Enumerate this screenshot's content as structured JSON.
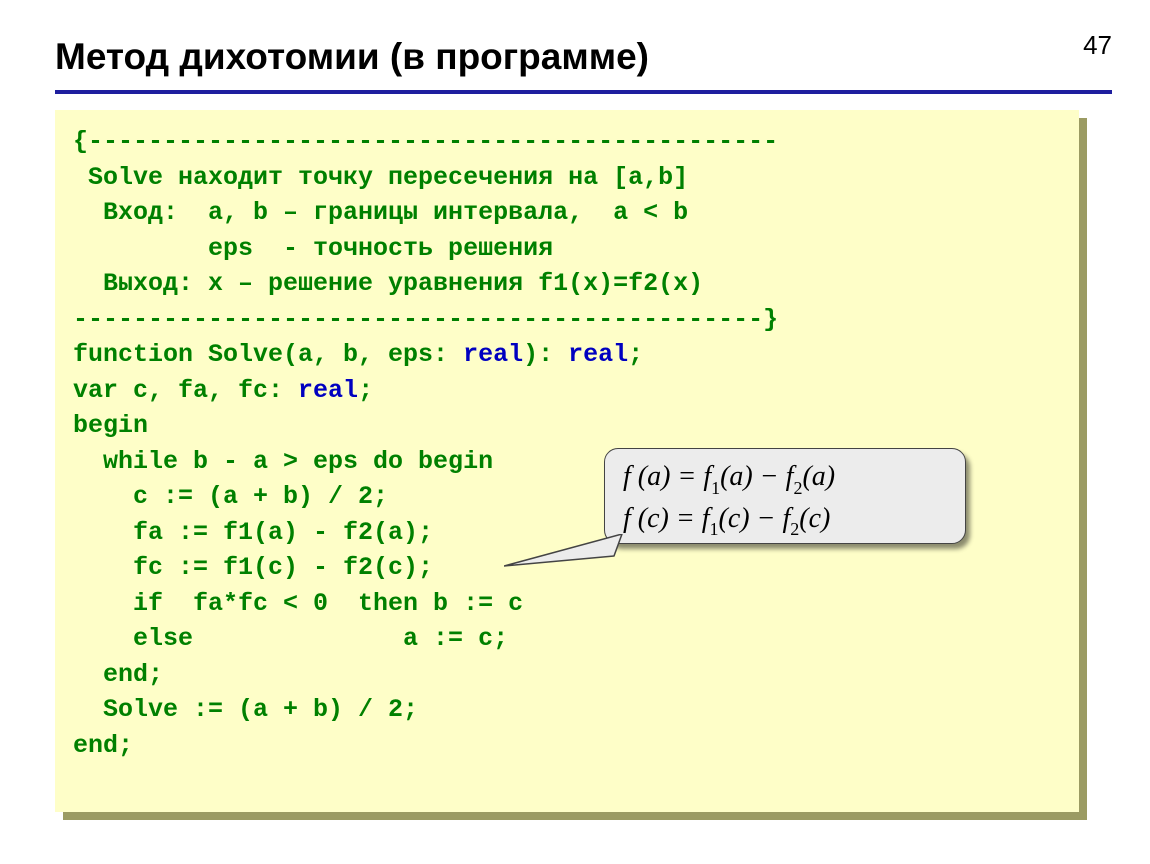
{
  "page_number": "47",
  "title": "Метод дихотомии (в программе)",
  "code": {
    "c01": "{----------------------------------------------",
    "c02": " Solve находит точку пересечения на [a,b]",
    "c03": "  Вход:  a, b – границы интервала,  a < b",
    "c04": "         eps  - точность решения",
    "c05": "  Выход: x – решение уравнения f1(x)=f2(x)",
    "c06": "----------------------------------------------}",
    "c07a": "function Solve(a, b, eps: ",
    "c07b": "real",
    "c07c": "): ",
    "c07d": "real",
    "c07e": ";",
    "c08a": "var c, fa, fc: ",
    "c08b": "real",
    "c08c": ";",
    "c09": "begin",
    "c10": "  while b - a > eps do begin",
    "c11": "    c := (a + b) / 2;",
    "c12": "    fa := f1(a) - f2(a);",
    "c13": "    fc := f1(c) - f2(c);",
    "c14": "    if  fa*fc < 0  then b := c",
    "c15": "    else              a := c;",
    "c16": "  end;",
    "c17": "  Solve := (a + b) / 2;",
    "c18": "end;"
  },
  "callout": {
    "l1": {
      "pre": "f (a) = f",
      "s1": "1",
      "mid1": "(a) − f",
      "s2": "2",
      "end": "(a)"
    },
    "l2": {
      "pre": "f (c) = f",
      "s1": "1",
      "mid1": "(c) − f",
      "s2": "2",
      "end": "(c)"
    }
  }
}
